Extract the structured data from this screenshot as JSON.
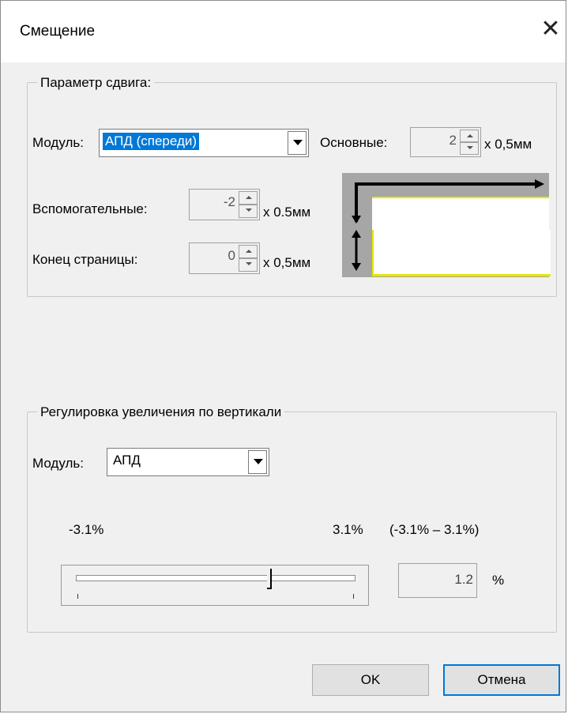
{
  "dialog": {
    "title": "Смещение",
    "close_glyph": "✕"
  },
  "shift_group": {
    "legend": "Параметр сдвига:",
    "module_label": "Модуль:",
    "module_value": "АПД (спереди)",
    "main_label": "Основные:",
    "main_value": "2",
    "main_unit": "x 0,5мм",
    "aux_label": "Вспомогательные:",
    "aux_value": "-2",
    "aux_unit": "x 0.5мм",
    "end_label": "Конец страницы:",
    "end_value": "0",
    "end_unit": "x 0,5мм"
  },
  "zoom_group": {
    "legend": "Регулировка увеличения по вертикали",
    "module_label": "Модуль:",
    "module_value": "АПД",
    "min_label": "-3.1%",
    "max_label": "3.1%",
    "range_label": "(-3.1% – 3.1%)",
    "slider_range": [
      -3.1,
      3.1
    ],
    "slider_value": 1.2,
    "value": "1.2",
    "unit": "%"
  },
  "buttons": {
    "ok": "OK",
    "cancel": "Отмена"
  },
  "colors": {
    "selection": "#0078d7",
    "highlight": "#e6e600"
  }
}
